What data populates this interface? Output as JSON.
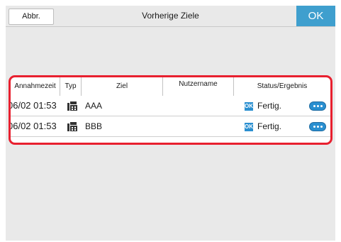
{
  "topbar": {
    "cancel_label": "Abbr.",
    "title": "Vorherige Ziele",
    "ok_label": "OK"
  },
  "table": {
    "headers": [
      "Annahmezeit",
      "Typ",
      "Ziel",
      "Nutzername",
      "Status/Ergebnis"
    ],
    "rows": [
      {
        "time": "06/02 01:53",
        "type_icon": "fax-icon",
        "target": "AAA",
        "user": "",
        "status_badge": "OK",
        "status": "Fertig.",
        "more_icon": "more-dots-icon"
      },
      {
        "time": "06/02 01:53",
        "type_icon": "fax-icon",
        "target": "BBB",
        "user": "",
        "status_badge": "OK",
        "status": "Fertig.",
        "more_icon": "more-dots-icon"
      }
    ]
  },
  "colors": {
    "accent": "#3f9fce",
    "highlight_border": "#e8202f",
    "badge": "#2a8fd0"
  }
}
